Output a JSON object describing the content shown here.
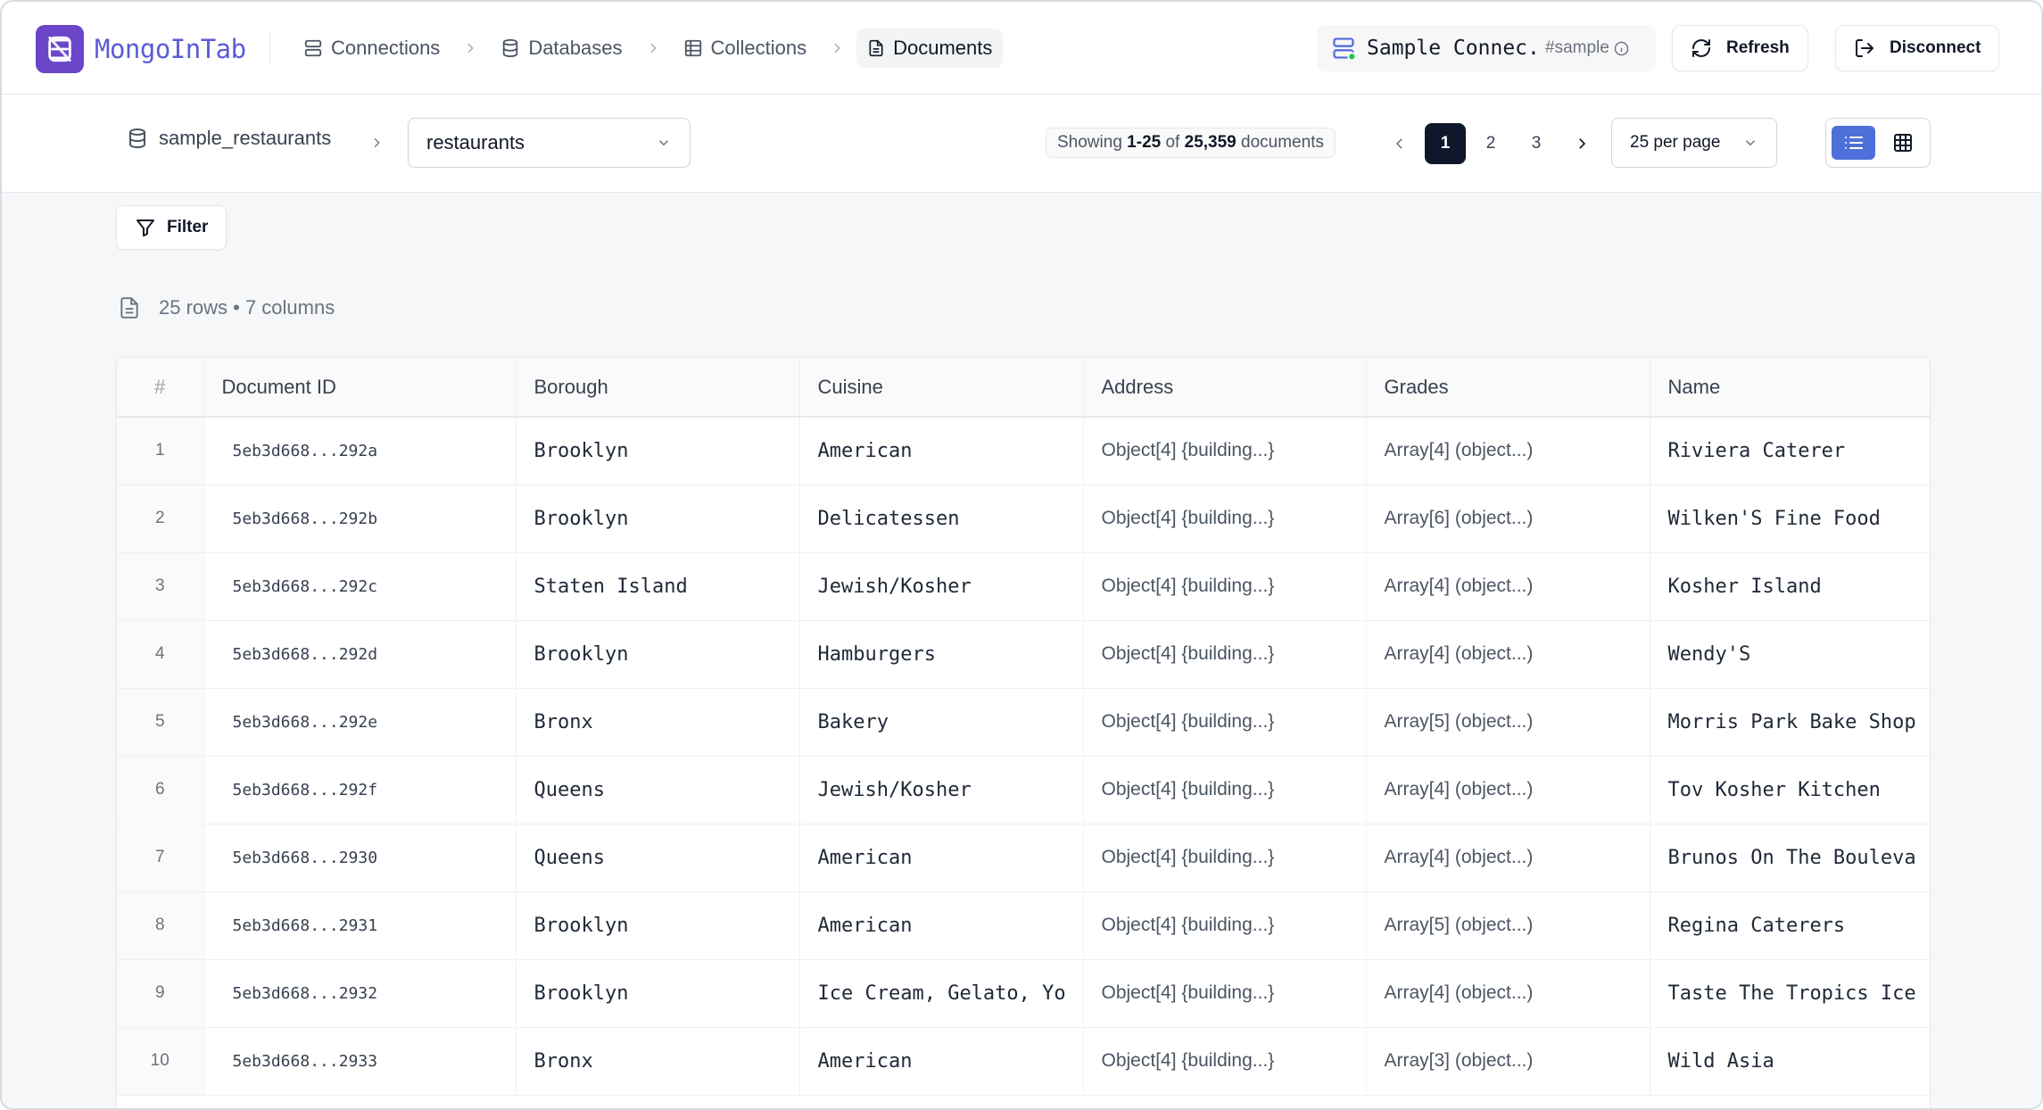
{
  "app": {
    "name": "MongoInTab"
  },
  "breadcrumb": {
    "items": [
      {
        "label": "Connections",
        "icon": "server-icon"
      },
      {
        "label": "Databases",
        "icon": "database-icon"
      },
      {
        "label": "Collections",
        "icon": "table-icon"
      },
      {
        "label": "Documents",
        "icon": "document-icon",
        "active": true
      }
    ]
  },
  "connection": {
    "name": "Sample Connec...",
    "tag": "#sample",
    "status_color": "#22c55e"
  },
  "header_buttons": {
    "refresh": "Refresh",
    "disconnect": "Disconnect"
  },
  "toolbar": {
    "database": "sample_restaurants",
    "collection": "restaurants",
    "showing_prefix": "Showing",
    "showing_range": "1-25",
    "showing_of": "of",
    "showing_total": "25,359",
    "showing_suffix": "documents",
    "pages": [
      "1",
      "2",
      "3"
    ],
    "current_page": "1",
    "per_page": "25 per page",
    "view_mode": "list"
  },
  "filter": {
    "label": "Filter"
  },
  "summary": "25 rows • 7 columns",
  "table": {
    "columns": [
      "#",
      "Document ID",
      "Borough",
      "Cuisine",
      "Address",
      "Grades",
      "Name"
    ],
    "rows": [
      [
        "1",
        "5eb3d668...292a",
        "Brooklyn",
        "American",
        "Object[4] {building...}",
        "Array[4] (object...)",
        "Riviera Caterer"
      ],
      [
        "2",
        "5eb3d668...292b",
        "Brooklyn",
        "Delicatessen",
        "Object[4] {building...}",
        "Array[6] (object...)",
        "Wilken'S Fine Food"
      ],
      [
        "3",
        "5eb3d668...292c",
        "Staten Island",
        "Jewish/Kosher",
        "Object[4] {building...}",
        "Array[4] (object...)",
        "Kosher Island"
      ],
      [
        "4",
        "5eb3d668...292d",
        "Brooklyn",
        "Hamburgers",
        "Object[4] {building...}",
        "Array[4] (object...)",
        "Wendy'S"
      ],
      [
        "5",
        "5eb3d668...292e",
        "Bronx",
        "Bakery",
        "Object[4] {building...}",
        "Array[5] (object...)",
        "Morris Park Bake Shop"
      ],
      [
        "6",
        "5eb3d668...292f",
        "Queens",
        "Jewish/Kosher",
        "Object[4] {building...}",
        "Array[4] (object...)",
        "Tov Kosher Kitchen"
      ],
      [
        "7",
        "5eb3d668...2930",
        "Queens",
        "American",
        "Object[4] {building...}",
        "Array[4] (object...)",
        "Brunos On The Bouleva"
      ],
      [
        "8",
        "5eb3d668...2931",
        "Brooklyn",
        "American",
        "Object[4] {building...}",
        "Array[5] (object...)",
        "Regina Caterers"
      ],
      [
        "9",
        "5eb3d668...2932",
        "Brooklyn",
        "Ice Cream, Gelato, Yo",
        "Object[4] {building...}",
        "Array[4] (object...)",
        "Taste The Tropics Ice"
      ],
      [
        "10",
        "5eb3d668...2933",
        "Bronx",
        "American",
        "Object[4] {building...}",
        "Array[3] (object...)",
        "Wild Asia"
      ]
    ]
  }
}
